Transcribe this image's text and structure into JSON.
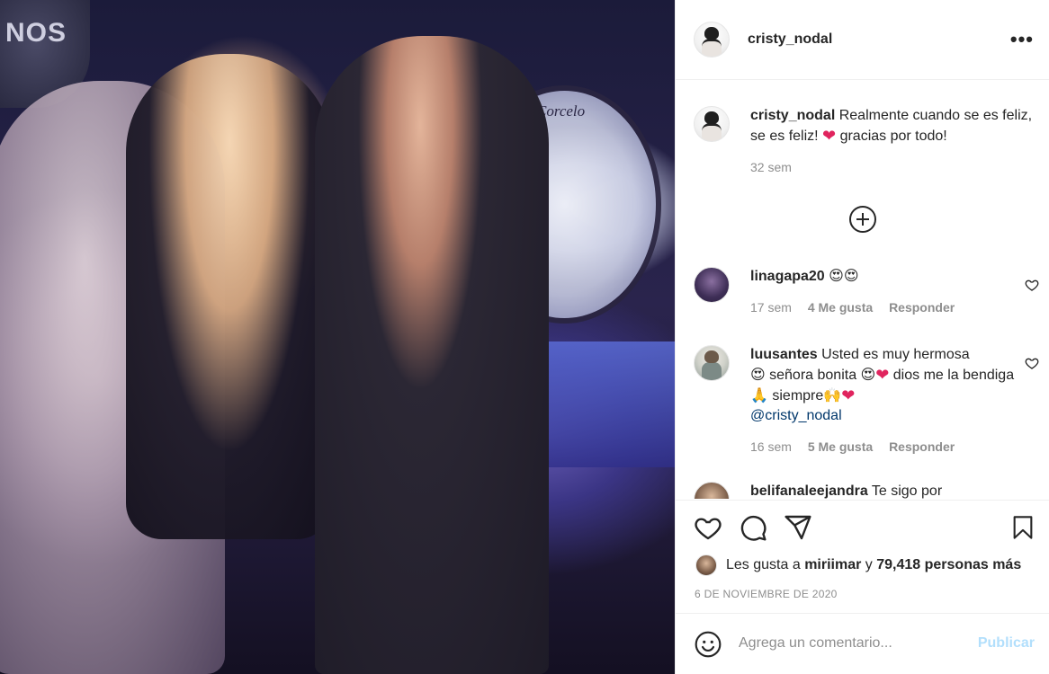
{
  "post": {
    "username": "cristy_nodal",
    "more_label": "•••"
  },
  "photo": {
    "sign_text": "NOS",
    "drum_logo": "Corcelo"
  },
  "caption": {
    "username": "cristy_nodal",
    "text_1": "Realmente cuando se es feliz, se es feliz! ",
    "text_2": " gracias por todo!",
    "time": "32 sem"
  },
  "comments": [
    {
      "username": "linagapa20",
      "time": "17 sem",
      "likes": "4 Me gusta",
      "reply": "Responder"
    },
    {
      "username": "luusantes",
      "text_1": "Usted es muy hermosa",
      "text_2": " señora bonita ",
      "text_3": " dios me la bendiga ",
      "text_4": " siempre",
      "mention": "@cristy_nodal",
      "time": "16 sem",
      "likes": "5 Me gusta",
      "reply": "Responder"
    },
    {
      "username": "belifanaleejandra",
      "text_1": "Te sigo por"
    }
  ],
  "likes": {
    "prefix": "Les gusta a ",
    "user": "miriimar",
    "middle": " y ",
    "count": "79,418 personas más"
  },
  "date": "6 DE NOVIEMBRE DE 2020",
  "compose": {
    "placeholder": "Agrega un comentario...",
    "publish": "Publicar"
  },
  "icons": {
    "more": "more-icon",
    "like": "heart-icon",
    "comment": "comment-icon",
    "share": "share-icon",
    "save": "bookmark-icon",
    "emoji": "emoji-icon",
    "load_more": "plus-circle-icon"
  },
  "colors": {
    "heart_red": "#e0245e",
    "publish_disabled": "#b2dffc",
    "mention": "#00376b",
    "meta_gray": "#8e8e8e"
  }
}
